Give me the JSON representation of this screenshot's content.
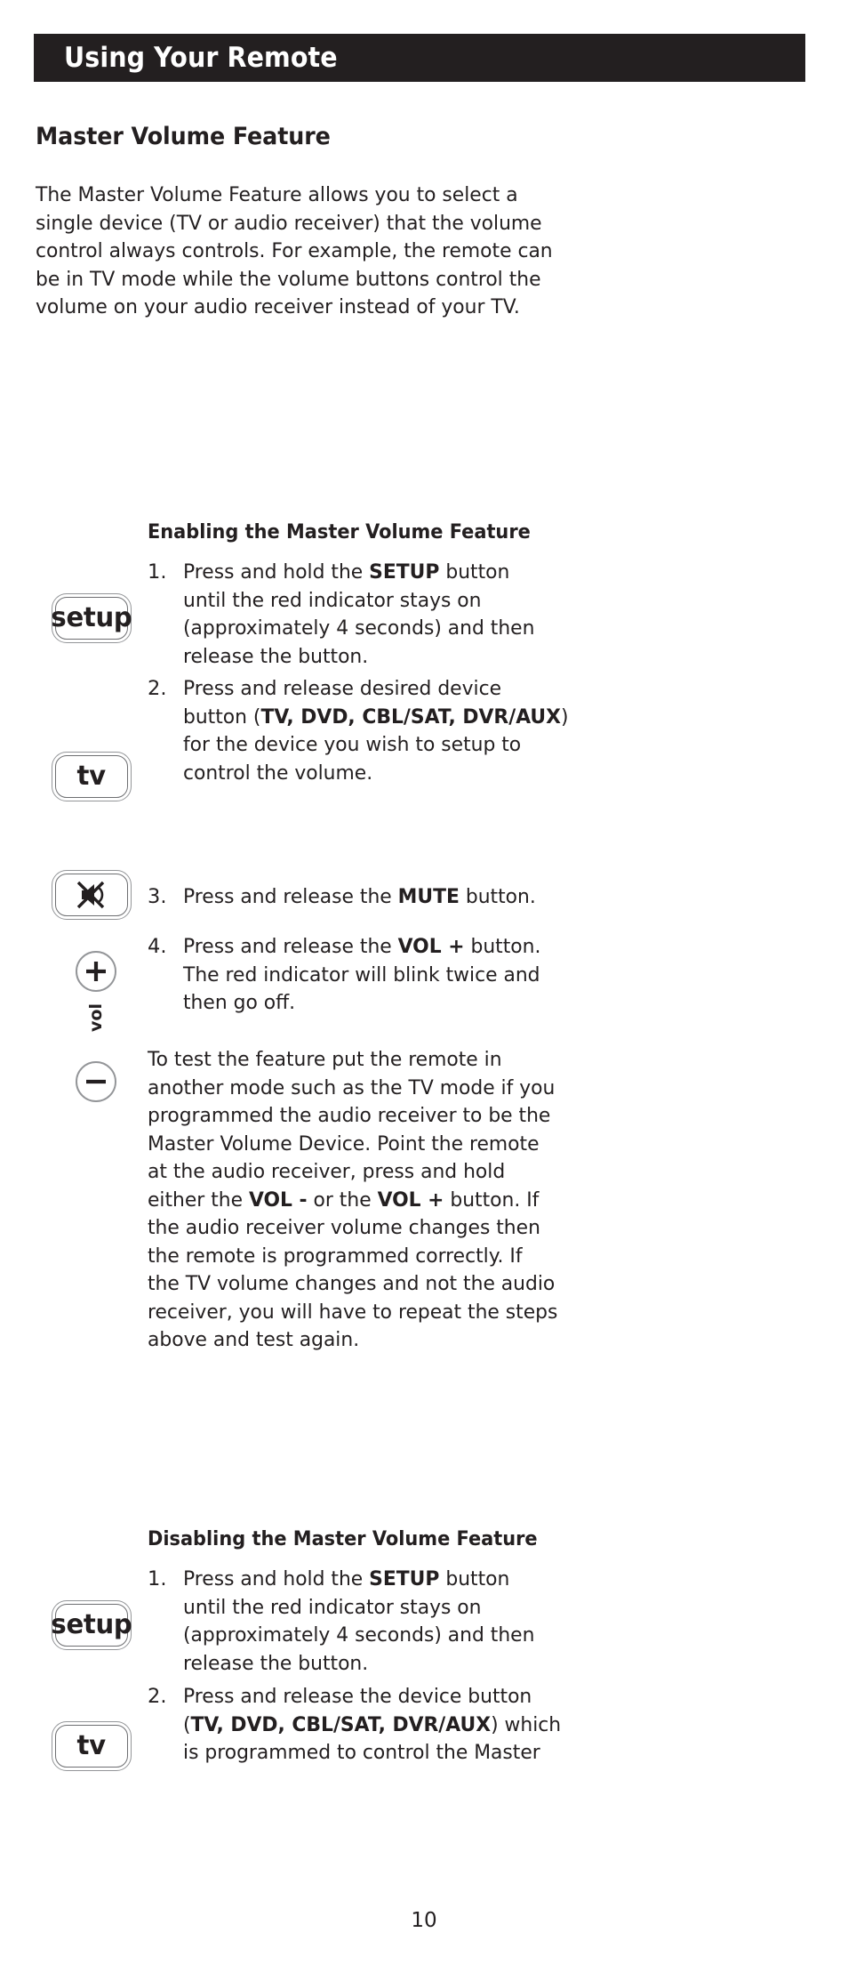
{
  "header": {
    "title": "Using Your Remote"
  },
  "section": {
    "title": "Master Volume Feature"
  },
  "intro": {
    "lines": [
      "The Master Volume Feature allows you to select a",
      "single device (TV or audio receiver) that the volume",
      "control always controls. For example, the remote can",
      "be in TV mode while the volume buttons control the",
      "volume on your audio receiver instead of your TV."
    ]
  },
  "enabling": {
    "heading": "Enabling the Master Volume Feature",
    "steps": [
      {
        "number": "1.",
        "lines": [
          [
            {
              "t": "Press and hold the "
            },
            {
              "t": "SETUP",
              "b": true
            },
            {
              "t": " button"
            }
          ],
          [
            {
              "t": "until the red indicator stays on"
            }
          ],
          [
            {
              "t": "(approximately 4 seconds) and then"
            }
          ],
          [
            {
              "t": "release the button."
            }
          ]
        ]
      },
      {
        "number": "2.",
        "lines": [
          [
            {
              "t": "Press and release desired device"
            }
          ],
          [
            {
              "t": "button ("
            },
            {
              "t": "TV, DVD, CBL/SAT, DVR/AUX",
              "b": true
            },
            {
              "t": ")"
            }
          ],
          [
            {
              "t": "for the device you wish to setup to"
            }
          ],
          [
            {
              "t": "control the volume."
            }
          ]
        ]
      },
      {
        "number": "3.",
        "lines": [
          [
            {
              "t": "Press and release the "
            },
            {
              "t": "MUTE",
              "b": true
            },
            {
              "t": " button."
            }
          ]
        ]
      },
      {
        "number": "4.",
        "lines": [
          [
            {
              "t": "Press and release the "
            },
            {
              "t": "VOL +",
              "b": true
            },
            {
              "t": " button."
            }
          ],
          [
            {
              "t": "The red indicator will blink twice and"
            }
          ],
          [
            {
              "t": "then go off."
            }
          ]
        ]
      }
    ]
  },
  "test_paragraph": {
    "lines": [
      [
        {
          "t": "To test the feature put the remote in"
        }
      ],
      [
        {
          "t": "another mode such as the TV mode if you"
        }
      ],
      [
        {
          "t": "programmed the audio receiver to be the"
        }
      ],
      [
        {
          "t": "Master Volume Device. Point the remote"
        }
      ],
      [
        {
          "t": "at the audio receiver, press and hold"
        }
      ],
      [
        {
          "t": "either the "
        },
        {
          "t": "VOL -",
          "b": true
        },
        {
          "t": " or the "
        },
        {
          "t": "VOL +",
          "b": true
        },
        {
          "t": " button. If"
        }
      ],
      [
        {
          "t": "the audio receiver volume changes then"
        }
      ],
      [
        {
          "t": "the remote is programmed correctly. If"
        }
      ],
      [
        {
          "t": "the TV volume changes and not the audio"
        }
      ],
      [
        {
          "t": "receiver, you will have to repeat the steps"
        }
      ],
      [
        {
          "t": "above and test again."
        }
      ]
    ]
  },
  "disabling": {
    "heading": "Disabling the Master Volume Feature",
    "steps": [
      {
        "number": "1.",
        "lines": [
          [
            {
              "t": "Press and hold the "
            },
            {
              "t": "SETUP",
              "b": true
            },
            {
              "t": " button"
            }
          ],
          [
            {
              "t": "until the red indicator stays on"
            }
          ],
          [
            {
              "t": "(approximately 4 seconds) and then"
            }
          ],
          [
            {
              "t": "release the button."
            }
          ]
        ]
      },
      {
        "number": "2.",
        "lines": [
          [
            {
              "t": "Press and release the device button"
            }
          ],
          [
            {
              "t": "("
            },
            {
              "t": "TV, DVD, CBL/SAT, DVR/AUX",
              "b": true
            },
            {
              "t": ") which"
            }
          ],
          [
            {
              "t": "is programmed to control the Master"
            }
          ]
        ]
      }
    ]
  },
  "remote_keys": {
    "setup_label": "setup",
    "tv_label": "tv",
    "mute_icon": "mute-speaker-icon",
    "vol_up_icon": "plus-icon",
    "vol_down_icon": "minus-icon",
    "vol_label": "vol"
  },
  "footer": {
    "page_number": "10"
  },
  "colors": {
    "header_bar": "#231f20",
    "header_text": "#ffffff",
    "body_text": "#231f20",
    "key_outline": "#6d6e71",
    "key_outline_outer": "#939598",
    "page_background": "#ffffff"
  }
}
